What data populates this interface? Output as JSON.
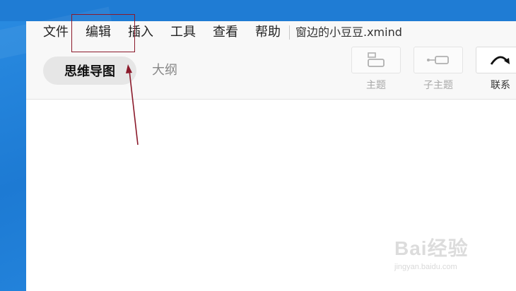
{
  "menubar": {
    "items": [
      "文件",
      "编辑",
      "插入",
      "工具",
      "查看",
      "帮助"
    ],
    "document_title": "窗边的小豆豆.xmind"
  },
  "view_tabs": {
    "active": "思维导图",
    "inactive": "大纲"
  },
  "tools": [
    {
      "label": "主题",
      "icon": "topic-icon"
    },
    {
      "label": "子主题",
      "icon": "subtopic-icon"
    },
    {
      "label": "联系",
      "icon": "relationship-icon"
    }
  ],
  "annotation": {
    "highlight_color": "#8b1a2b"
  },
  "watermark": {
    "brand": "Bai经验",
    "url": "jingyan.baidu.com"
  }
}
